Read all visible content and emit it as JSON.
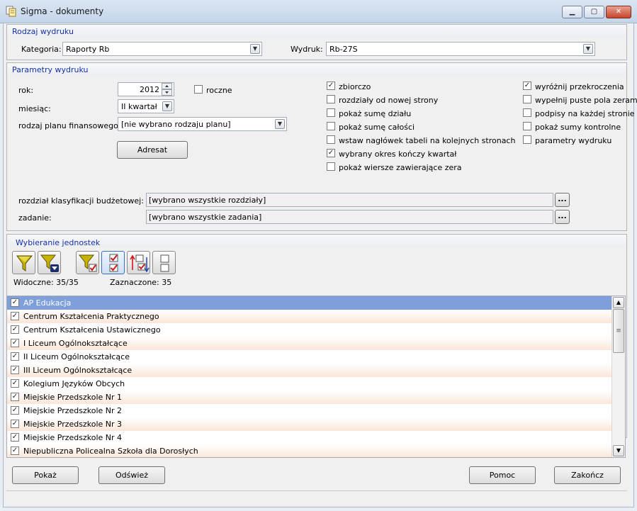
{
  "window": {
    "title": "Sigma - dokumenty",
    "min_glyph": "▁",
    "max_glyph": "▢",
    "close_glyph": "✕"
  },
  "rodzaj": {
    "header": "Rodzaj wydruku",
    "kategoria_label": "Kategoria:",
    "kategoria_value": "Raporty Rb",
    "wydruk_label": "Wydruk:",
    "wydruk_value": "Rb-27S"
  },
  "parametry": {
    "header": "Parametry wydruku",
    "rok_label": "rok:",
    "rok_value": "2012",
    "roczne_label": "roczne",
    "roczne_checked": false,
    "miesiac_label": "miesiąc:",
    "miesiac_value": "II kwartał",
    "plan_label": "rodzaj planu finansowego:",
    "plan_value": "[nie wybrano rodzaju planu]",
    "adresat_label": "Adresat",
    "options_mid": [
      {
        "label": "zbiorczo",
        "checked": true
      },
      {
        "label": "rozdziały od nowej strony",
        "checked": false
      },
      {
        "label": "pokaż sumę działu",
        "checked": false
      },
      {
        "label": "pokaż sumę całości",
        "checked": false
      },
      {
        "label": "wstaw nagłówek tabeli na kolejnych stronach",
        "checked": false
      },
      {
        "label": "wybrany okres kończy kwartał",
        "checked": true
      },
      {
        "label": "pokaż wiersze zawierające zera",
        "checked": false
      }
    ],
    "options_right": [
      {
        "label": "wyróżnij przekroczenia",
        "checked": true
      },
      {
        "label": "wypełnij puste pola zerami",
        "checked": false
      },
      {
        "label": "podpisy na każdej stronie",
        "checked": false
      },
      {
        "label": "pokaż sumy kontrolne",
        "checked": false
      },
      {
        "label": "parametry wydruku",
        "checked": false
      }
    ],
    "rozdzial_label": "rozdział klasyfikacji budżetowej:",
    "rozdzial_value": "[wybrano wszystkie rozdziały]",
    "zadanie_label": "zadanie:",
    "zadanie_value": "[wybrano wszystkie zadania]",
    "dots_label": "..."
  },
  "jednostki": {
    "header": "Wybieranie jednostek",
    "widoczne": "Widoczne: 35/35",
    "zaznaczone": "Zaznaczone: 35",
    "items": [
      {
        "label": "AP Edukacja",
        "checked": true
      },
      {
        "label": "Centrum Kształcenia Praktycznego",
        "checked": true
      },
      {
        "label": "Centrum Kształcenia Ustawicznego",
        "checked": true
      },
      {
        "label": "I Liceum Ogólnokształcące",
        "checked": true
      },
      {
        "label": "II Liceum Ogólnokształcące",
        "checked": true
      },
      {
        "label": "III Liceum Ogólnokształcące",
        "checked": true
      },
      {
        "label": "Kolegium Języków Obcych",
        "checked": true
      },
      {
        "label": "Miejskie Przedszkole Nr 1",
        "checked": true
      },
      {
        "label": "Miejskie Przedszkole Nr 2",
        "checked": true
      },
      {
        "label": "Miejskie Przedszkole Nr 3",
        "checked": true
      },
      {
        "label": "Miejskie Przedszkole Nr 4",
        "checked": true
      },
      {
        "label": "Niepubliczna Policealna Szkoła dla Dorosłych",
        "checked": true
      }
    ],
    "scroll_up": "▲",
    "scroll_down": "▼",
    "thumb_grip": "≡"
  },
  "footer": {
    "pokaz": "Pokaż",
    "odswiez": "Odśwież",
    "pomoc": "Pomoc",
    "zakoncz": "Zakończ"
  },
  "colors": {
    "accent_blue": "#1530a8",
    "selection": "#7f9fdb"
  }
}
